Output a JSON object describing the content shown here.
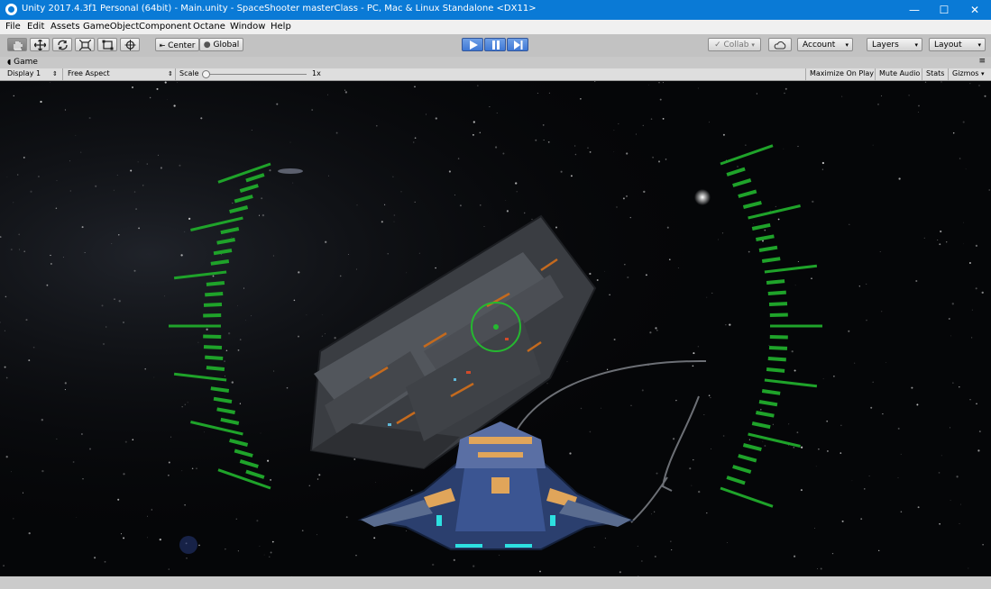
{
  "window": {
    "title": "Unity 2017.4.3f1 Personal (64bit) - Main.unity - SpaceShooter masterClass - PC, Mac & Linux Standalone <DX11>",
    "controls": [
      "—",
      "☐",
      "✕"
    ]
  },
  "menu": [
    "File",
    "Edit",
    "Assets",
    "GameObject",
    "Component",
    "Octane",
    "Window",
    "Help"
  ],
  "toolbar": {
    "tools": [
      "hand-tool",
      "move-tool",
      "rotate-tool",
      "scale-tool",
      "rect-tool",
      "transform-tool"
    ],
    "pivot_label": "Center",
    "rotation_label": "Global",
    "collab_label": "Collab",
    "account_label": "Account",
    "layers_label": "Layers",
    "layout_label": "Layout"
  },
  "game_tab": {
    "title": "Game",
    "display": "Display 1",
    "aspect": "Free Aspect",
    "scale_label": "Scale",
    "scale_value": "1x",
    "maximize_on_play": "Maximize On Play",
    "mute_audio": "Mute Audio",
    "stats": "Stats",
    "gizmos": "Gizmos"
  },
  "colors": {
    "titlebar": "#0a7ad6",
    "hud_green": "#1fa32a",
    "play_blue": "#3f78d5",
    "space": "#050608"
  }
}
